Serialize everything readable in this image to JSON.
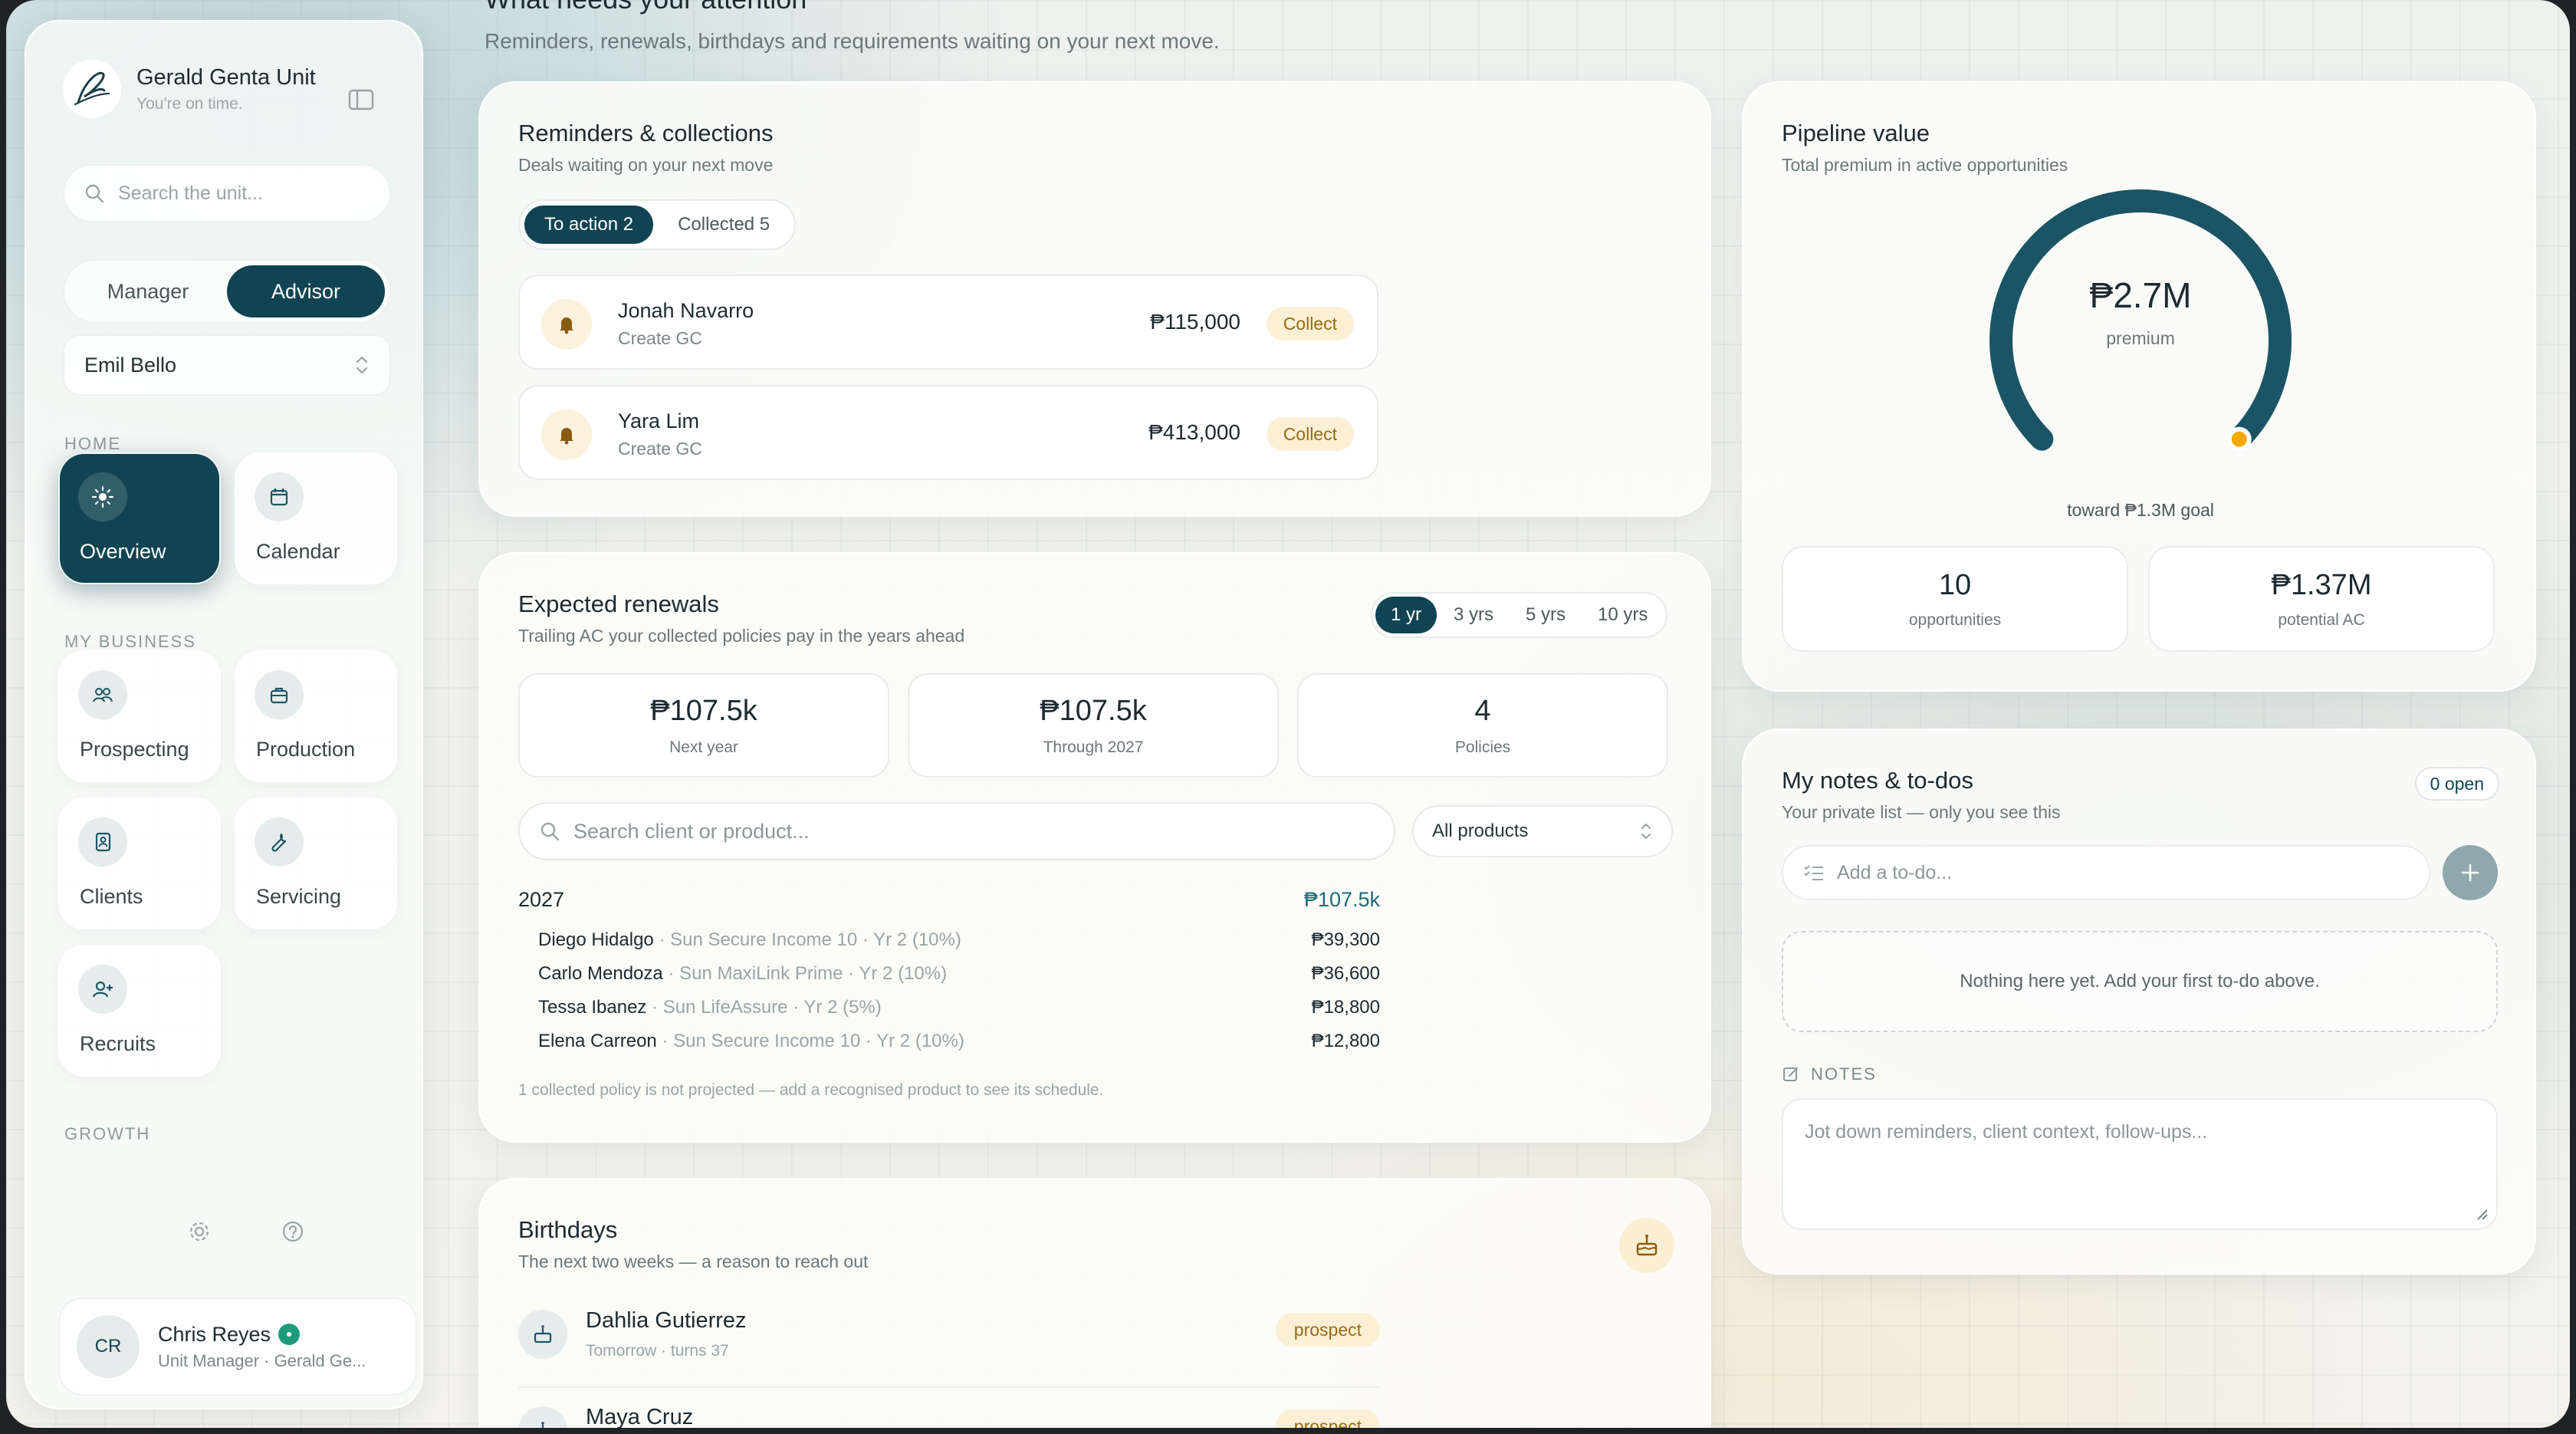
{
  "brand": {
    "title": "Gerald Genta Unit",
    "subtitle": "You're on time."
  },
  "sidebar": {
    "search_placeholder": "Search the unit...",
    "roles": [
      "Manager",
      "Advisor"
    ],
    "active_role": "Advisor",
    "selected_advisor": "Emil Bello",
    "sections": {
      "home": "HOME",
      "my_business": "MY BUSINESS",
      "growth": "GROWTH"
    },
    "items": [
      {
        "label": "Overview",
        "icon": "sun-icon",
        "active": true
      },
      {
        "label": "Calendar",
        "icon": "calendar-icon"
      },
      {
        "label": "Prospecting",
        "icon": "people-icon"
      },
      {
        "label": "Production",
        "icon": "briefcase-icon"
      },
      {
        "label": "Clients",
        "icon": "contact-book-icon"
      },
      {
        "label": "Servicing",
        "icon": "wrench-icon"
      },
      {
        "label": "Recruits",
        "icon": "user-plus-icon"
      }
    ],
    "user": {
      "initials": "CR",
      "name": "Chris Reyes",
      "role": "Unit Manager · Gerald Ge..."
    }
  },
  "page": {
    "title": "What needs your attention",
    "subtitle": "Reminders, renewals, birthdays and requirements waiting on your next move."
  },
  "reminders": {
    "title": "Reminders & collections",
    "subtitle": "Deals waiting on your next move",
    "tabs": [
      "To action 2",
      "Collected 5"
    ],
    "rows": [
      {
        "name": "Jonah Navarro",
        "sub": "Create GC",
        "amount": "₱115,000",
        "action": "Collect"
      },
      {
        "name": "Yara Lim",
        "sub": "Create GC",
        "amount": "₱413,000",
        "action": "Collect"
      }
    ]
  },
  "renewals": {
    "title": "Expected renewals",
    "subtitle": "Trailing AC your collected policies pay in the years ahead",
    "ranges": [
      "1 yr",
      "3 yrs",
      "5 yrs",
      "10 yrs"
    ],
    "active_range": "1 yr",
    "stats": [
      {
        "value": "₱107.5k",
        "label": "Next year"
      },
      {
        "value": "₱107.5k",
        "label": "Through 2027"
      },
      {
        "value": "4",
        "label": "Policies"
      }
    ],
    "search_placeholder": "Search client or product...",
    "product_filter": "All products",
    "year": "2027",
    "year_total": "₱107.5k",
    "lines": [
      {
        "name": "Diego Hidalgo",
        "detail": "· Sun Secure Income 10 · Yr 2 (10%)",
        "amount": "₱39,300"
      },
      {
        "name": "Carlo Mendoza",
        "detail": "· Sun MaxiLink Prime · Yr 2 (10%)",
        "amount": "₱36,600"
      },
      {
        "name": "Tessa Ibanez",
        "detail": "· Sun LifeAssure · Yr 2 (5%)",
        "amount": "₱18,800"
      },
      {
        "name": "Elena Carreon",
        "detail": "· Sun Secure Income 10 · Yr 2 (10%)",
        "amount": "₱12,800"
      }
    ],
    "footnote": "1 collected policy is not projected — add a recognised product to see its schedule."
  },
  "birthdays": {
    "title": "Birthdays",
    "subtitle": "The next two weeks — a reason to reach out",
    "rows": [
      {
        "name": "Dahlia Gutierrez",
        "sub": "Tomorrow · turns 37",
        "tag": "prospect"
      },
      {
        "name": "Maya Cruz",
        "sub": "",
        "tag": "prospect"
      }
    ]
  },
  "pipeline": {
    "title": "Pipeline value",
    "subtitle": "Total premium in active opportunities",
    "gauge_value": "₱2.7M",
    "gauge_label": "premium",
    "gauge_progress": 1.0,
    "goal_text": "toward ₱1.3M goal",
    "stats": [
      {
        "value": "10",
        "label": "opportunities"
      },
      {
        "value": "₱1.37M",
        "label": "potential AC"
      }
    ],
    "colors": {
      "track": "#1b5565",
      "marker": "#f2a900"
    }
  },
  "notes": {
    "title": "My notes & to-dos",
    "subtitle": "Your private list — only you see this",
    "open_badge": "0 open",
    "todo_placeholder": "Add a to-do...",
    "empty_text": "Nothing here yet. Add your first to-do above.",
    "notes_label": "NOTES",
    "notes_placeholder": "Jot down reminders, client context, follow-ups..."
  }
}
